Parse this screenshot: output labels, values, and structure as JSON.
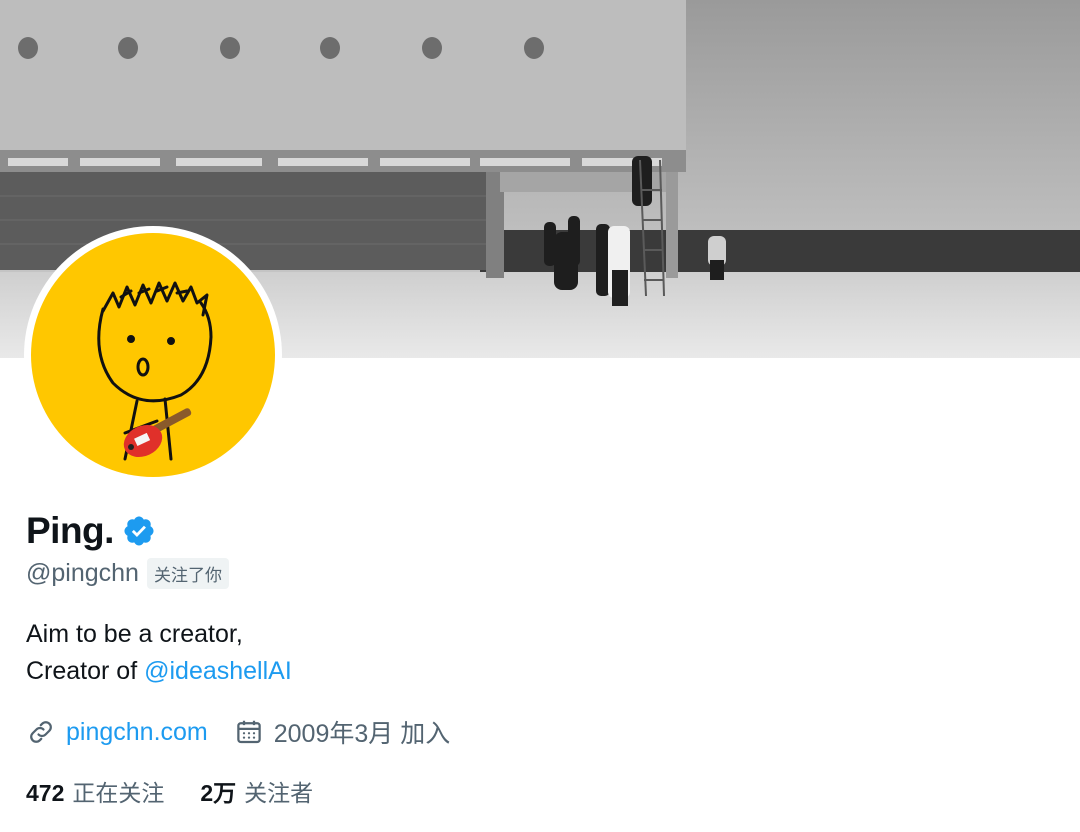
{
  "profile": {
    "display_name": "Ping.",
    "handle": "@pingchn",
    "follows_you": "关注了你",
    "bio_line1": "Aim to be a creator,",
    "bio_line2_prefix": "Creator of ",
    "bio_mention": "@ideashellAI",
    "website": "pingchn.com",
    "joined": "2009年3月 加入",
    "following_count": "472",
    "following_label": "正在关注",
    "followers_count": "2万",
    "followers_label": "关注者"
  },
  "icons": {
    "verified": "verified-badge-icon",
    "link": "link-icon",
    "calendar": "calendar-icon"
  },
  "colors": {
    "accent": "#1d9bf0",
    "secondary_text": "#536471",
    "avatar_bg": "#ffc700"
  }
}
